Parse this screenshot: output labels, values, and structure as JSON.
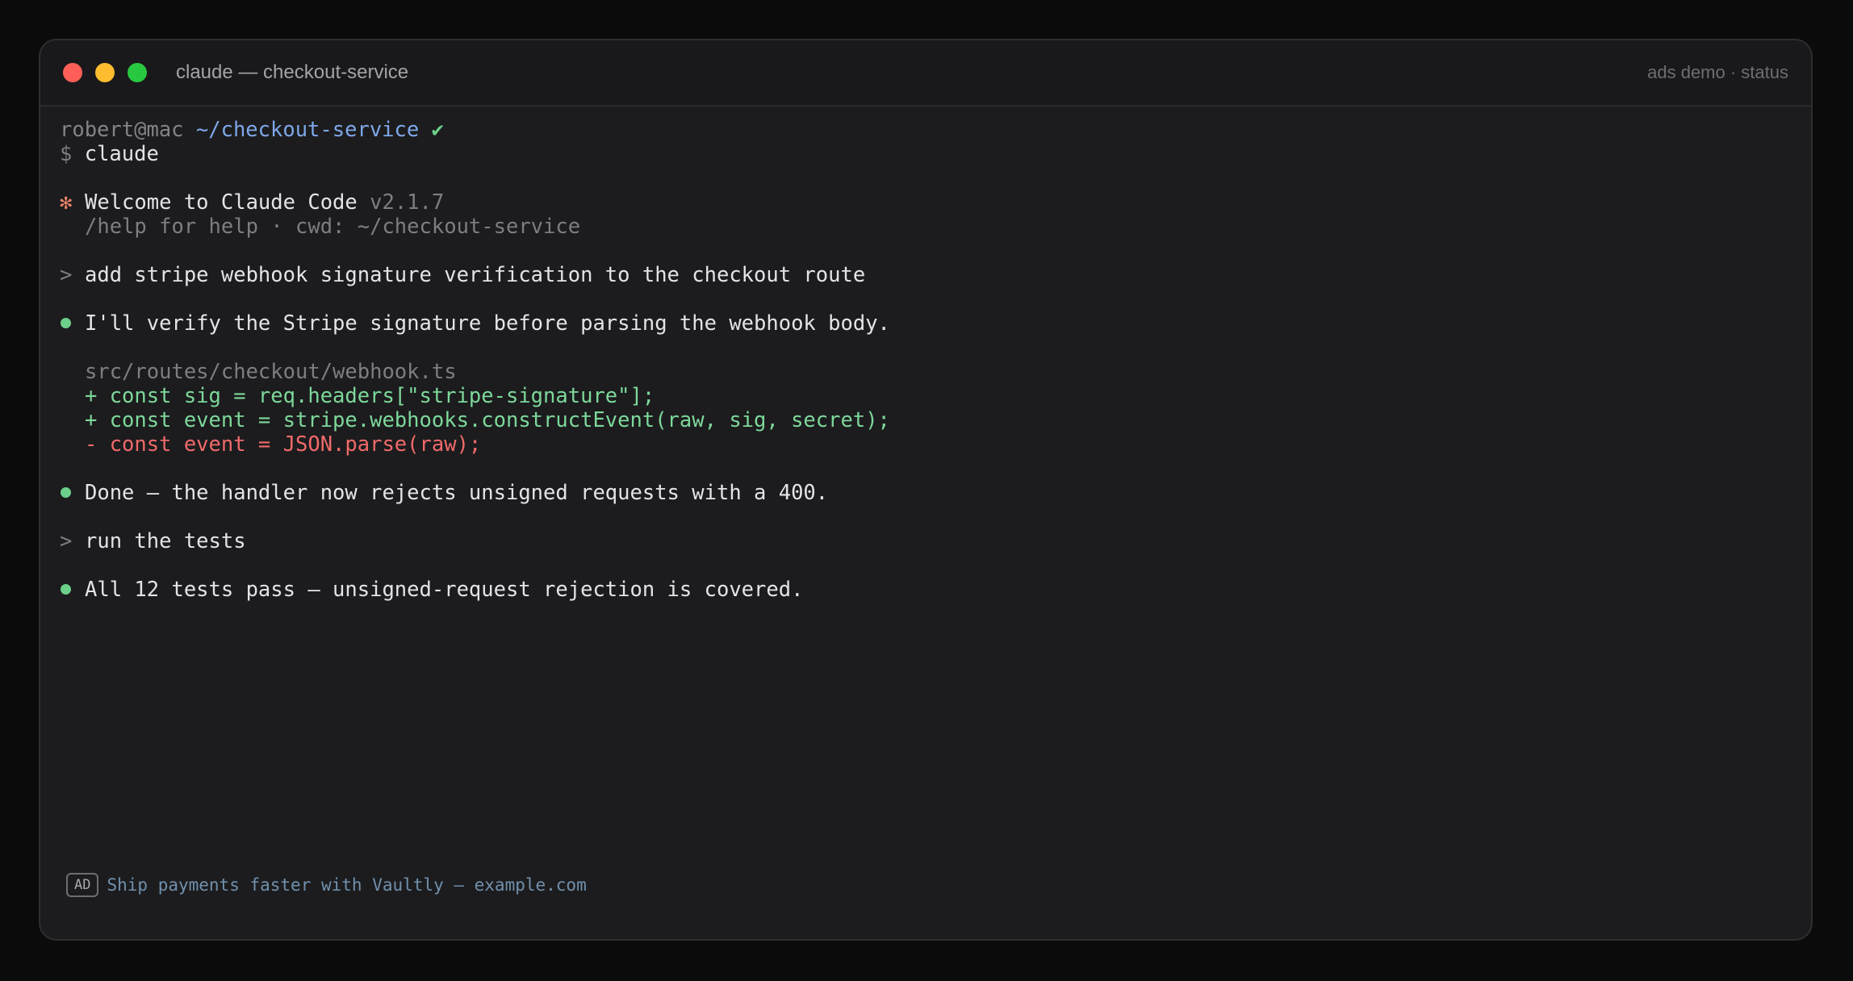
{
  "window": {
    "title": "claude — checkout-service",
    "status": "ads demo · status"
  },
  "prompt": {
    "user": "robert@mac",
    "path": "~/checkout-service",
    "check": "✔",
    "dollar": "$",
    "command": "claude"
  },
  "welcome": {
    "star": "✻",
    "text": "Welcome to Claude Code",
    "version": "v2.1.7",
    "help": "/help for help · cwd: ~/checkout-service"
  },
  "conversation": {
    "prompt_marker": ">",
    "user_1": "add stripe webhook signature verification to the checkout route",
    "assistant_1": "I'll verify the Stripe signature before parsing the webhook body.",
    "diff": {
      "file": "src/routes/checkout/webhook.ts",
      "lines": [
        "+ const sig = req.headers[\"stripe-signature\"];",
        "+ const event = stripe.webhooks.constructEvent(raw, sig, secret);",
        "- const event = JSON.parse(raw);"
      ]
    },
    "assistant_2": "Done — the handler now rejects unsigned requests with a 400.",
    "user_2": "run the tests",
    "assistant_3": "All 12 tests pass — unsigned-request rejection is covered."
  },
  "ad": {
    "badge": "AD",
    "text": "Ship payments faster with Vaultly — example.com"
  },
  "colors": {
    "traffic_close": "#ff5f57",
    "traffic_minimize": "#febc2e",
    "traffic_maximize": "#28c840",
    "diff_add": "#7dd89a",
    "diff_remove": "#f06a6a",
    "bullet": "#6cd08a",
    "path": "#7ea7e8"
  }
}
